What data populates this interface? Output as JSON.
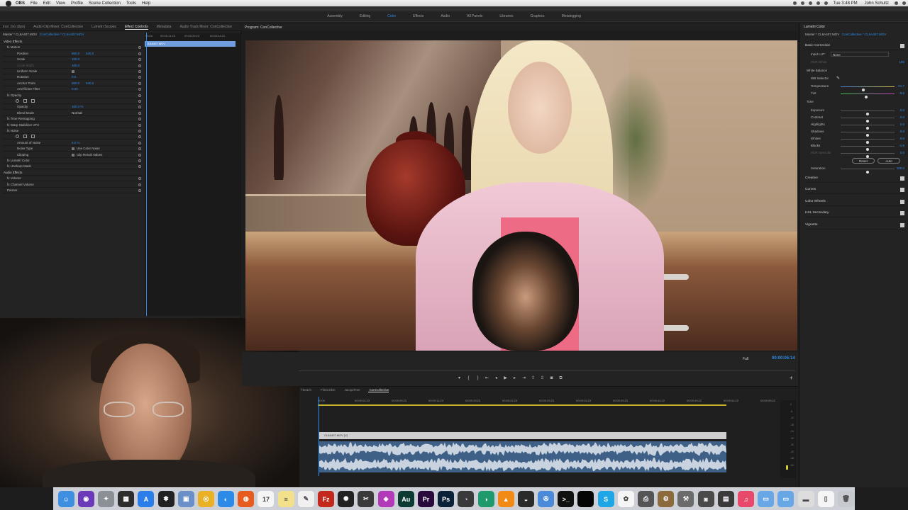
{
  "menubar": {
    "app": "OBS",
    "items": [
      "File",
      "Edit",
      "View",
      "Profile",
      "Scene Collection",
      "Tools",
      "Help"
    ],
    "clock": "Tue 3:48 PM",
    "user": "John Schultz"
  },
  "workspaces": {
    "items": [
      "Assembly",
      "Editing",
      "Color",
      "Effects",
      "Audio",
      "All Panels",
      "Libraries",
      "Graphics",
      "Metalogging"
    ],
    "active": "Color"
  },
  "effect_controls": {
    "tabs": [
      "irce: (no clips)",
      "Audio Clip Mixer: ConCollective",
      "Lumetri Scopes",
      "Effect Controls",
      "Metadata",
      "Audio Track Mixer: ConCollective"
    ],
    "active_tab": "Effect Controls",
    "master": "Master * CL6A407.MOV",
    "sequence": "ConCollective * CL6A407.MOV",
    "ruler": [
      "00:00",
      "00:00:14:23",
      "00:00:29:23",
      "00:00:44:22"
    ],
    "clip_name": "CL6A407.MOV",
    "rows": [
      {
        "label": "Video Effects",
        "kind": "section"
      },
      {
        "label": "fx  Motion",
        "kind": "top"
      },
      {
        "label": "Position",
        "v1": "960.0",
        "v2": "540.0"
      },
      {
        "label": "Scale",
        "v1": "100.0"
      },
      {
        "label": "Scale Width",
        "v1": "100.0",
        "dim": true
      },
      {
        "label": "Uniform Scale",
        "check": true
      },
      {
        "label": "Rotation",
        "v1": "0.0"
      },
      {
        "label": "Anchor Point",
        "v1": "960.0",
        "v2": "540.0"
      },
      {
        "label": "Anti-flicker Filter",
        "v1": "0.00"
      },
      {
        "label": "fx  Opacity",
        "kind": "top"
      },
      {
        "label": "",
        "kind": "icons"
      },
      {
        "label": "Opacity",
        "v1": "100.0 %"
      },
      {
        "label": "Blend Mode",
        "v1": "Normal",
        "plain": true
      },
      {
        "label": "fx  Time Remapping",
        "kind": "top"
      },
      {
        "label": "fx  Warp Stabilizer VFX",
        "kind": "top"
      },
      {
        "label": "fx  Noise",
        "kind": "top"
      },
      {
        "label": "",
        "kind": "icons"
      },
      {
        "label": "Amount of Noise",
        "v1": "5.0 %"
      },
      {
        "label": "Noise Type",
        "check": true,
        "checklabel": "Use Color Noise"
      },
      {
        "label": "Clipping",
        "check": true,
        "checklabel": "Clip Result Values"
      },
      {
        "label": "fx  Lumetri Color",
        "kind": "top"
      },
      {
        "label": "fx  Unsharp Mask",
        "kind": "top"
      },
      {
        "label": "Audio Effects",
        "kind": "section"
      },
      {
        "label": "fx  Volume",
        "kind": "top"
      },
      {
        "label": "fx  Channel Volume",
        "kind": "top"
      },
      {
        "label": "Panner",
        "kind": "top"
      }
    ]
  },
  "program": {
    "title": "Program: ConCollective",
    "fit": "Full",
    "timecode": "00:00:05:14"
  },
  "timeline": {
    "tabs": [
      "f-beach",
      "FilmicSkin",
      "JacquiTree",
      "ConCollective"
    ],
    "active_tab": "ConCollective",
    "ruler": [
      "00:00",
      "00:00:04:23",
      "00:00:09:23",
      "00:00:14:23",
      "00:00:19:23",
      "00:00:24:23",
      "00:00:29:23",
      "00:00:34:23",
      "00:00:39:23",
      "00:00:44:22",
      "00:00:49:22",
      "00:00:54:22",
      "00:00:59:22"
    ],
    "video_clip": "CL6A407.MOV [V]",
    "vu_labels": [
      "0",
      "-6",
      "-12",
      "-18",
      "-24",
      "-30",
      "-36",
      "-42",
      "-48",
      "-54"
    ]
  },
  "lumetri": {
    "title": "Lumetri Color",
    "master": "Master * CL6A407.MOV",
    "sequence": "ConCollective * CL6A407.MOV",
    "basic_correction": "Basic Correction",
    "input_lut_label": "Input LUT",
    "input_lut_value": "None",
    "hdr_white_label": "HDR White",
    "hdr_white_value": "100",
    "white_balance": "White Balance",
    "wb_selector": "WB Selector",
    "tone": "Tone",
    "sliders": [
      {
        "label": "Temperature",
        "value": "-21.7",
        "pos": 0.42
      },
      {
        "label": "Tint",
        "value": "-9.5",
        "pos": 0.47
      },
      {
        "label": "Exposure",
        "value": "0.0",
        "pos": 0.5
      },
      {
        "label": "Contrast",
        "value": "0.0",
        "pos": 0.5
      },
      {
        "label": "Highlights",
        "value": "0.0",
        "pos": 0.5
      },
      {
        "label": "Shadows",
        "value": "0.0",
        "pos": 0.5
      },
      {
        "label": "Whites",
        "value": "0.0",
        "pos": 0.5
      },
      {
        "label": "Blacks",
        "value": "-1.5",
        "pos": 0.5
      },
      {
        "label": "HDR Specular",
        "value": "0.0",
        "pos": 0.5,
        "dim": true
      }
    ],
    "reset": "Reset",
    "auto": "Auto",
    "saturation_label": "Saturation",
    "saturation_value": "100.0",
    "sections": [
      "Creative",
      "Curves",
      "Color Wheels",
      "HSL Secondary",
      "Vignette"
    ]
  },
  "dock": {
    "apps": [
      {
        "name": "finder-icon",
        "color": "#3f8fe0",
        "glyph": "☺"
      },
      {
        "name": "siri-icon",
        "color": "#6a3ab8",
        "glyph": "◉"
      },
      {
        "name": "launchpad-icon",
        "color": "#8b8f96",
        "glyph": "✦"
      },
      {
        "name": "mission-control-icon",
        "color": "#2d2d2d",
        "glyph": "▦"
      },
      {
        "name": "app-store-icon",
        "color": "#2b7de9",
        "glyph": "A"
      },
      {
        "name": "dashboard-icon",
        "color": "#222",
        "glyph": "✱"
      },
      {
        "name": "preview-icon",
        "color": "#6b8fc7",
        "glyph": "▣"
      },
      {
        "name": "chrome-icon",
        "color": "#e8b126",
        "glyph": "◎"
      },
      {
        "name": "safari-icon",
        "color": "#2b8be6",
        "glyph": "◐"
      },
      {
        "name": "firefox-icon",
        "color": "#e65b1e",
        "glyph": "◍"
      },
      {
        "name": "calendar-icon",
        "color": "#f5f5f5",
        "glyph": "17"
      },
      {
        "name": "notes-icon",
        "color": "#f3e08a",
        "glyph": "≡"
      },
      {
        "name": "textedit-icon",
        "color": "#f0f0f0",
        "glyph": "✎"
      },
      {
        "name": "filezilla-icon",
        "color": "#c3281c",
        "glyph": "Fz"
      },
      {
        "name": "davinci-icon",
        "color": "#222",
        "glyph": "✺"
      },
      {
        "name": "final-cut-icon",
        "color": "#3a3a3a",
        "glyph": "✂"
      },
      {
        "name": "motion-icon",
        "color": "#b23ab8",
        "glyph": "◈"
      },
      {
        "name": "audition-icon",
        "color": "#0c3b33",
        "glyph": "Au"
      },
      {
        "name": "premiere-icon",
        "color": "#2a0a3c",
        "glyph": "Pr"
      },
      {
        "name": "photoshop-icon",
        "color": "#0b2137",
        "glyph": "Ps"
      },
      {
        "name": "resolve-icon",
        "color": "#3a3a3a",
        "glyph": "◔"
      },
      {
        "name": "color-finale-icon",
        "color": "#1f9a6c",
        "glyph": "◑"
      },
      {
        "name": "vlc-icon",
        "color": "#f28a16",
        "glyph": "▲"
      },
      {
        "name": "obs-icon",
        "color": "#2a2a2a",
        "glyph": "◒"
      },
      {
        "name": "xcode-icon",
        "color": "#4b8ad8",
        "glyph": "✇"
      },
      {
        "name": "terminal-icon",
        "color": "#111",
        "glyph": ">_"
      },
      {
        "name": "black-app-icon",
        "color": "#050505",
        "glyph": ""
      },
      {
        "name": "skype-icon",
        "color": "#1ea6e6",
        "glyph": "S"
      },
      {
        "name": "photos-icon",
        "color": "#f5f5f5",
        "glyph": "✿"
      },
      {
        "name": "printer-icon",
        "color": "#555",
        "glyph": "⎙"
      },
      {
        "name": "automator-icon",
        "color": "#8b6b3c",
        "glyph": "⚙"
      },
      {
        "name": "utility-icon",
        "color": "#6b6b6b",
        "glyph": "⚒"
      },
      {
        "name": "camera-icon",
        "color": "#4a4a4a",
        "glyph": "◙"
      },
      {
        "name": "disk-icon",
        "color": "#3a3a3a",
        "glyph": "▤"
      },
      {
        "name": "itunes-icon",
        "color": "#e8486a",
        "glyph": "♫"
      },
      {
        "name": "folder-icon",
        "color": "#68a7e6",
        "glyph": "▭"
      },
      {
        "name": "folder2-icon",
        "color": "#68a7e6",
        "glyph": "▭"
      },
      {
        "name": "drive-icon",
        "color": "#ddd",
        "glyph": "▬"
      },
      {
        "name": "document-icon",
        "color": "#f5f5f5",
        "glyph": "▯"
      },
      {
        "name": "trash-icon",
        "color": "#c6c9cd",
        "glyph": "🗑"
      }
    ]
  }
}
